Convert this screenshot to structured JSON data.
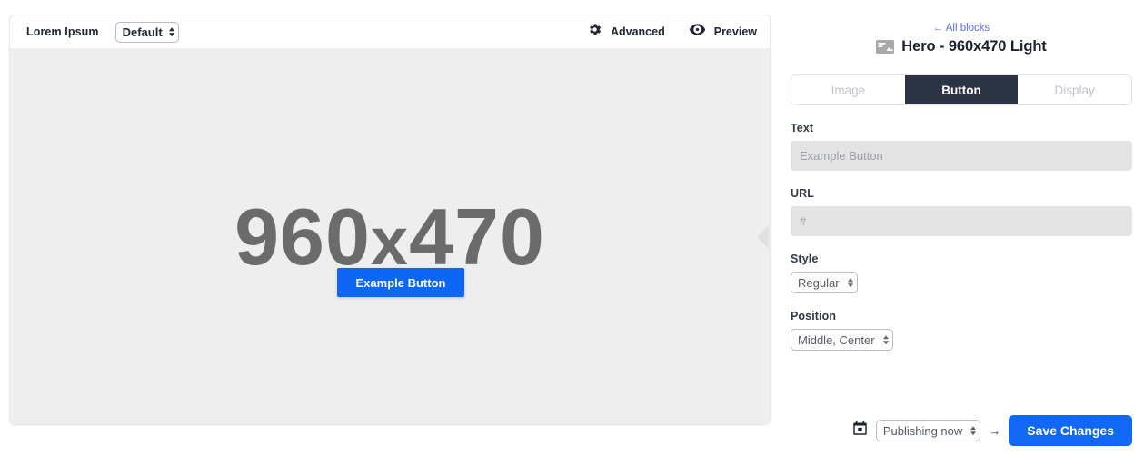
{
  "editor": {
    "toolbar": {
      "title": "Lorem Ipsum",
      "template_select": {
        "value": "Default",
        "options": [
          "Default"
        ]
      },
      "advanced_label": "Advanced",
      "advanced_icon": "gear-icon",
      "preview_label": "Preview",
      "preview_icon": "eye-icon"
    },
    "canvas": {
      "placeholder_width": "960",
      "placeholder_separator": "x",
      "placeholder_height": "470",
      "placeholder_text": "960 x 470",
      "background_color": "#eeeeee",
      "placeholder_text_color": "#6b6b6b",
      "overlay_button": {
        "label": "Example Button",
        "color": "#0d66f5",
        "text_color": "#ffffff"
      },
      "collapse_handle_icon": "chevron-left-icon"
    }
  },
  "panel": {
    "back_link": "← All blocks",
    "back_link_color": "#5b6ef0",
    "block_icon": "hero-image-block-icon",
    "title": "Hero - 960x470 Light",
    "tabs": [
      {
        "label": "Image",
        "active": false
      },
      {
        "label": "Button",
        "active": true
      },
      {
        "label": "Display",
        "active": false
      }
    ],
    "active_tab_color": "#2b3344",
    "fields": {
      "text": {
        "label": "Text",
        "value": "",
        "placeholder": "Example Button"
      },
      "url": {
        "label": "URL",
        "value": "",
        "placeholder": "#"
      },
      "style": {
        "label": "Style",
        "value": "Regular",
        "options": [
          "Regular"
        ]
      },
      "position": {
        "label": "Position",
        "value": "Middle, Center",
        "options": [
          "Middle, Center"
        ]
      }
    },
    "footer": {
      "calendar_icon": "calendar-icon",
      "publish_select": {
        "value": "Publishing now",
        "options": [
          "Publishing now"
        ]
      },
      "arrow": "→",
      "save_label": "Save Changes",
      "save_color": "#1068f5"
    }
  }
}
